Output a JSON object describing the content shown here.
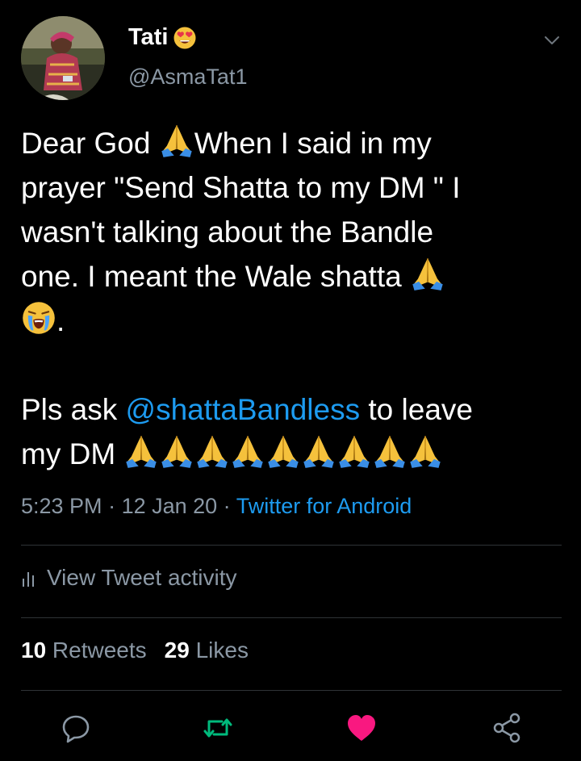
{
  "tweet": {
    "display_name": "Tati",
    "handle": "@AsmaTat1",
    "text_parts": {
      "p1": "Dear God ",
      "p2": "When I said in my\nprayer \"Send Shatta to my DM \" I\nwasn't talking about the Bandle\none. I meant the Wale shatta ",
      "p3": ".\n\nPls ask ",
      "mention": "@shattaBandless",
      "p4": " to leave\nmy DM "
    },
    "time": "5:23 PM",
    "date": "12 Jan 20",
    "separator": " · ",
    "source": "Twitter for Android"
  },
  "activity": {
    "label": "View Tweet activity"
  },
  "stats": {
    "retweets_count": "10",
    "retweets_label": " Retweets",
    "likes_count": "29",
    "likes_label": " Likes"
  },
  "icons": {
    "name_emoji": "smiling-face-with-heart-eyes",
    "pray": "folded-hands",
    "sob": "loudly-crying-face",
    "reply": "reply-icon",
    "retweet": "retweet-icon",
    "like": "heart-icon",
    "share": "share-icon",
    "caret": "chevron-down-icon",
    "analytics": "bar-chart-icon"
  },
  "colors": {
    "background": "#000000",
    "text": "#ffffff",
    "secondary": "#8b98a5",
    "link": "#1d9bf0",
    "retweet_green": "#00ba7c",
    "like_pink": "#f91880",
    "divider": "#2f3336"
  }
}
